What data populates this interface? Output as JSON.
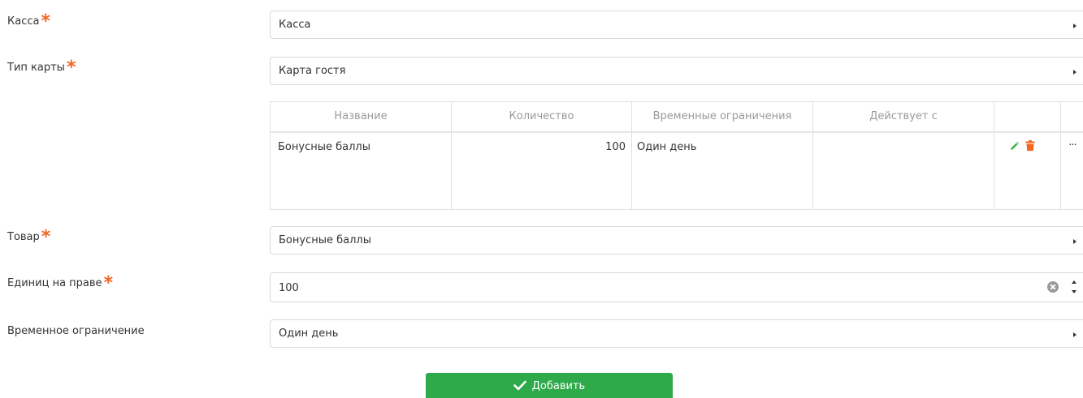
{
  "form": {
    "cash_register": {
      "label": "Касса",
      "value": "Касса"
    },
    "card_type": {
      "label": "Тип карты",
      "value": "Карта гостя"
    },
    "product": {
      "label": "Товар",
      "value": "Бонусные баллы"
    },
    "units_per_right": {
      "label": "Единиц на праве",
      "value": "100"
    },
    "time_limit": {
      "label": "Временное ограничение",
      "value": "Один день"
    },
    "required_mark": "*",
    "submit_label": "Добавить"
  },
  "table": {
    "columns": [
      "Название",
      "Количество",
      "Временные ограничения",
      "Действует с"
    ],
    "rows": [
      {
        "name": "Бонусные баллы",
        "quantity": "100",
        "time_limit": "Один день",
        "valid_from": ""
      }
    ],
    "more_label": "···"
  },
  "colors": {
    "required": "#f26522",
    "edit_icon": "#3cb54a",
    "delete_icon": "#f26522",
    "submit_bg": "#2eaa4a"
  },
  "icons": {
    "dropdown": "caret-right-icon",
    "edit": "pencil-icon",
    "delete": "trash-icon",
    "clear": "clear-icon",
    "submit": "check-icon"
  }
}
